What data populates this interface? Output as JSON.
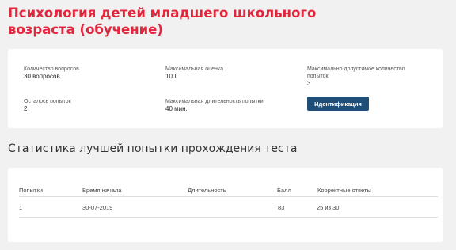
{
  "page": {
    "title": "Психология детей младшего школьного возраста (обучение)"
  },
  "info": {
    "questions_label": "Количество вопросов",
    "questions_value": "30 вопросов",
    "max_score_label": "Максимальная оценка",
    "max_score_value": "100",
    "max_attempts_label": "Максимально допустимое количество попыток",
    "max_attempts_value": "3",
    "attempts_left_label": "Осталось попыток",
    "attempts_left_value": "2",
    "max_duration_label": "Максимальная длительность попытки",
    "max_duration_value": "40 мин.",
    "identify_button": "Идентификация"
  },
  "stats": {
    "title": "Статистика лучшей попытки прохождения теста",
    "columns": [
      "Попытки",
      "Время начала",
      "Длительность",
      "Балл",
      "Корректные ответы"
    ],
    "rows": [
      [
        "1",
        "30-07-2019",
        "",
        "83",
        "25 из 30"
      ]
    ]
  },
  "colors": {
    "accent_title": "#e3263c",
    "button": "#1f4e79"
  }
}
